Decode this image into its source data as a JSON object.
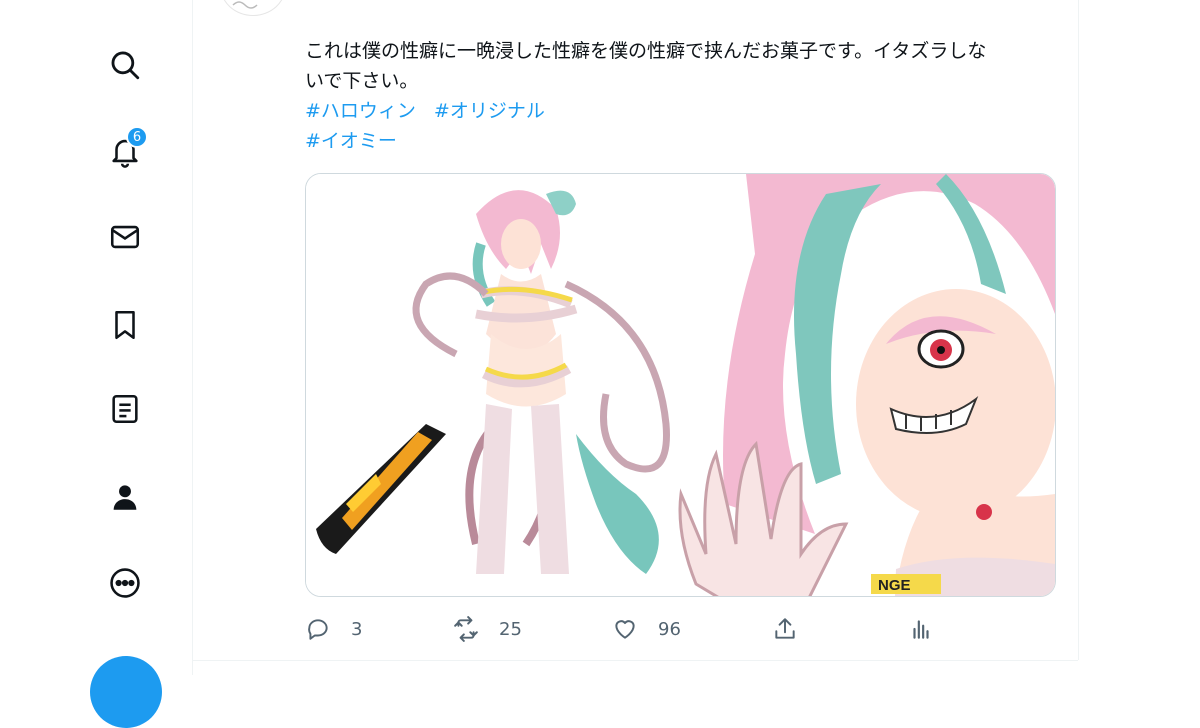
{
  "sidebar": {
    "notification_count": "6"
  },
  "tweet": {
    "text_lines": [
      "これは僕の性癖に一晩浸した性癖を僕の性癖で挟んだお菓子です。イタズラしな",
      "いで下さい。"
    ],
    "hashtags_row1": [
      "#ハロウィン",
      "#オリジナル"
    ],
    "hashtags_row2": [
      "#イオミー"
    ],
    "media_caution_text": "NGE"
  },
  "actions": {
    "reply_count": "3",
    "retweet_count": "25",
    "like_count": "96"
  },
  "icons": [
    "search-icon",
    "bell-icon",
    "mail-icon",
    "bookmark-icon",
    "lists-icon",
    "profile-icon",
    "more-icon",
    "reply-icon",
    "retweet-icon",
    "like-icon",
    "share-icon",
    "analytics-icon"
  ],
  "colors": {
    "accent": "#1d9bf0",
    "text": "#0f1419",
    "muted": "#536471",
    "border": "#cfd9de"
  }
}
